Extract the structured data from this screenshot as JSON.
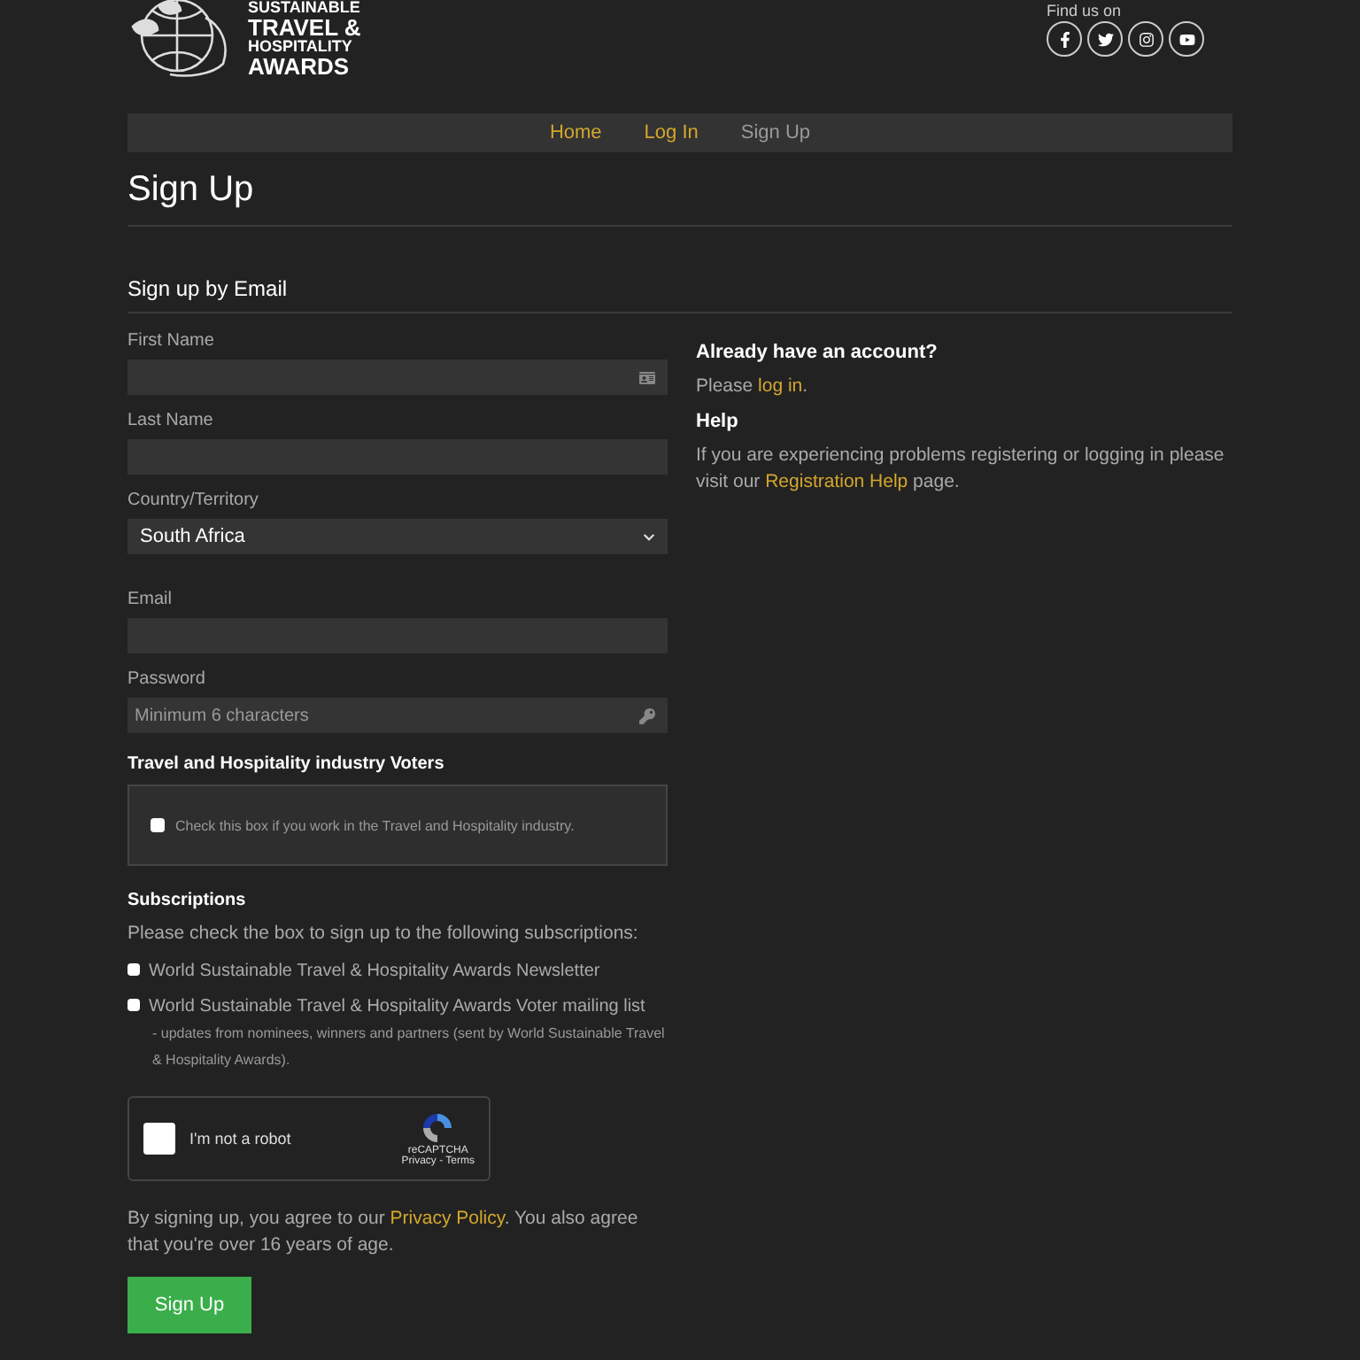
{
  "logo": {
    "lines": [
      "SUSTAINABLE",
      "TRAVEL &",
      "HOSPITALITY",
      "AWARDS"
    ]
  },
  "social": {
    "label": "Find us on",
    "icons": [
      {
        "kind": "facebook"
      },
      {
        "kind": "twitter"
      },
      {
        "kind": "instagram"
      },
      {
        "kind": "youtube"
      }
    ]
  },
  "breadcrumb": [
    {
      "label": "Home",
      "selected": false
    },
    {
      "label": "Log In",
      "selected": false
    },
    {
      "label": "Sign Up",
      "selected": true
    }
  ],
  "title": "Sign Up",
  "section_title": "Sign up by Email",
  "fields": [
    {
      "kind": "text",
      "label": "First Name",
      "icon": true
    },
    {
      "kind": "text",
      "label": "Last Name"
    },
    {
      "kind": "select",
      "label": "Country/Territory",
      "value": "South Africa"
    },
    {
      "kind": "text",
      "label": "Email"
    },
    {
      "kind": "password",
      "label": "Password",
      "placeholder": "Minimum 6 characters",
      "icon": true
    }
  ],
  "voters": {
    "title": "Travel and Hospitality industry Voters",
    "checkbox": {
      "label": "Check this box if you work in the Travel and Hospitality industry.",
      "checked": false
    }
  },
  "subscriptions": {
    "title": "Subscriptions",
    "intro": "Please check the box to sign up to the following subscriptions:",
    "items": [
      {
        "label": "World Sustainable Travel & Hospitality Awards Newsletter",
        "checked": false
      },
      {
        "label": "World Sustainable Travel & Hospitality Awards Voter mailing list",
        "note": "- updates from nominees, winners and partners (sent by World Sustainable Travel & Hospitality Awards).",
        "checked": false
      }
    ]
  },
  "captcha": {
    "label": "I'm not a robot",
    "checked": false,
    "brand": "reCAPTCHA",
    "links": "Privacy - Terms"
  },
  "agreement": {
    "before": "By signing up, you agree to our ",
    "link": "Privacy Policy",
    "after": ". You also agree that you're over 16 years of age."
  },
  "submit": "Sign Up",
  "aside": [
    {
      "title": "Already have an account?",
      "before": "Please ",
      "link": "log in",
      "after": "."
    },
    {
      "title": "Help",
      "before": "If you are experiencing problems registering or logging in please visit our ",
      "link": "Registration Help",
      "after": " page."
    }
  ]
}
